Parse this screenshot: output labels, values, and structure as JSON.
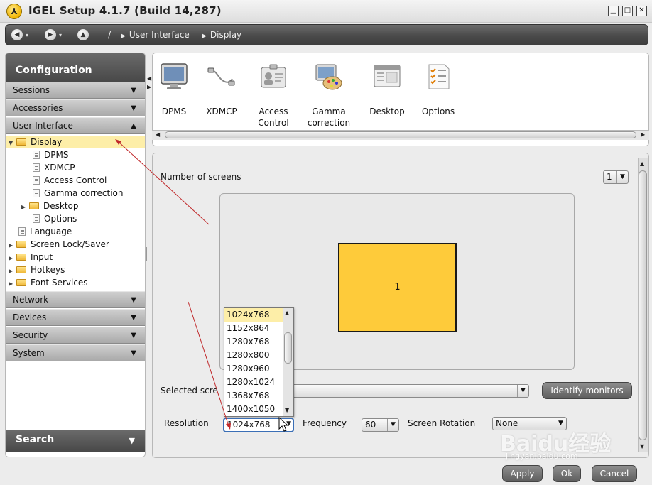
{
  "window": {
    "logo_glyph": "⅄",
    "title": "IGEL Setup 4.1.7 (Build 14,287)",
    "buttons": {
      "minimize": "▁",
      "maximize": "□",
      "close": "✕"
    }
  },
  "navbar": {
    "root": "/",
    "crumbs": [
      "User Interface",
      "Display"
    ]
  },
  "sidebar": {
    "header": "Configuration",
    "sections_top": [
      "Sessions",
      "Accessories",
      "User Interface"
    ],
    "tree": [
      {
        "label": "Display",
        "level": 0,
        "expanded": true,
        "type": "folder",
        "selected": true
      },
      {
        "label": "DPMS",
        "level": 1,
        "type": "doc"
      },
      {
        "label": "XDMCP",
        "level": 1,
        "type": "doc"
      },
      {
        "label": "Access Control",
        "level": 1,
        "type": "doc"
      },
      {
        "label": "Gamma correction",
        "level": 1,
        "type": "doc"
      },
      {
        "label": "Desktop",
        "level": 1,
        "type": "folder",
        "collapsed": true
      },
      {
        "label": "Options",
        "level": 1,
        "type": "doc"
      },
      {
        "label": "Language",
        "level": 0,
        "type": "doc"
      },
      {
        "label": "Screen Lock/Saver",
        "level": 0,
        "type": "folder",
        "collapsed": true
      },
      {
        "label": "Input",
        "level": 0,
        "type": "folder",
        "collapsed": true
      },
      {
        "label": "Hotkeys",
        "level": 0,
        "type": "folder",
        "collapsed": true
      },
      {
        "label": "Font Services",
        "level": 0,
        "type": "folder",
        "collapsed": true
      }
    ],
    "sections_bottom": [
      "Network",
      "Devices",
      "Security",
      "System"
    ],
    "search": "Search"
  },
  "toolbar": {
    "items": [
      {
        "label": "DPMS",
        "icon": "monitor-icon"
      },
      {
        "label": "XDMCP",
        "icon": "cable-icon"
      },
      {
        "label": "Access Control",
        "icon": "id-badge-icon"
      },
      {
        "label": "Gamma correction",
        "icon": "palette-icon"
      },
      {
        "label": "Desktop",
        "icon": "desktop-window-icon"
      },
      {
        "label": "Options",
        "icon": "checklist-icon"
      }
    ]
  },
  "display": {
    "number_of_screens_label": "Number of screens",
    "number_of_screens_value": "1",
    "monitor_label": "1",
    "selected_screen_label": "Selected scre",
    "identify_button": "Identify monitors",
    "resolution_label": "Resolution",
    "resolution_value": "1024x768",
    "resolution_options": [
      "1024x768",
      "1152x864",
      "1280x768",
      "1280x800",
      "1280x960",
      "1280x1024",
      "1368x768",
      "1400x1050"
    ],
    "frequency_label": "Frequency",
    "frequency_value": "60",
    "rotation_label": "Screen Rotation",
    "rotation_value": "None"
  },
  "footer": {
    "apply": "Apply",
    "ok": "Ok",
    "cancel": "Cancel"
  },
  "watermark": {
    "main": "Baidu经验",
    "sub": "jingyan.baidu.com"
  },
  "colors": {
    "selection": "#fdeea8",
    "monitor": "#fecb3a",
    "annotation": "#c0282a"
  }
}
